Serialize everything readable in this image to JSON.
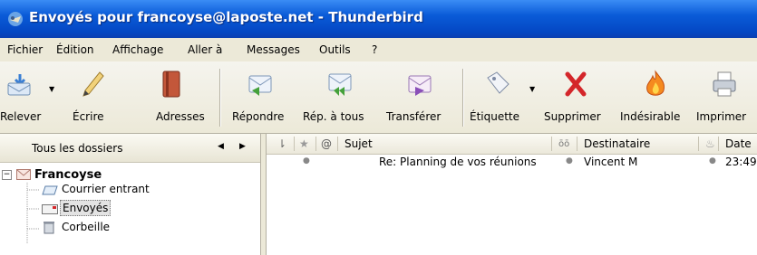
{
  "window": {
    "title": "Envoyés pour francoyse@laposte.net - Thunderbird"
  },
  "menu": [
    "Fichier",
    "Édition",
    "Affichage",
    "Aller à",
    "Messages",
    "Outils",
    "?"
  ],
  "toolbar": {
    "buttons": [
      {
        "label": "Relever",
        "icon": "get-mail-icon"
      },
      {
        "label": "Écrire",
        "icon": "pencil-icon"
      },
      {
        "label": "Adresses",
        "icon": "address-book-icon"
      },
      {
        "label": "Répondre",
        "icon": "reply-icon"
      },
      {
        "label": "Rép. à tous",
        "icon": "reply-all-icon"
      },
      {
        "label": "Transférer",
        "icon": "forward-icon"
      },
      {
        "label": "Étiquette",
        "icon": "tag-icon"
      },
      {
        "label": "Supprimer",
        "icon": "delete-icon"
      },
      {
        "label": "Indésirable",
        "icon": "junk-flame-icon"
      },
      {
        "label": "Imprimer",
        "icon": "printer-icon"
      }
    ]
  },
  "folder_pane": {
    "header": "Tous les dossiers",
    "account": "Francoyse",
    "folders": [
      "Courrier entrant",
      "Envoyés",
      "Corbeille"
    ],
    "selected": "Envoyés"
  },
  "thread_pane": {
    "columns": {
      "subject": "Sujet",
      "recipient": "Destinataire",
      "date": "Date"
    },
    "rows": [
      {
        "subject": "Re: Planning de vos réunions",
        "recipient": "Vincent M",
        "date": "23:49"
      }
    ]
  },
  "colors": {
    "titlebar": "#0a5bd8",
    "delete": "#d4262a"
  }
}
